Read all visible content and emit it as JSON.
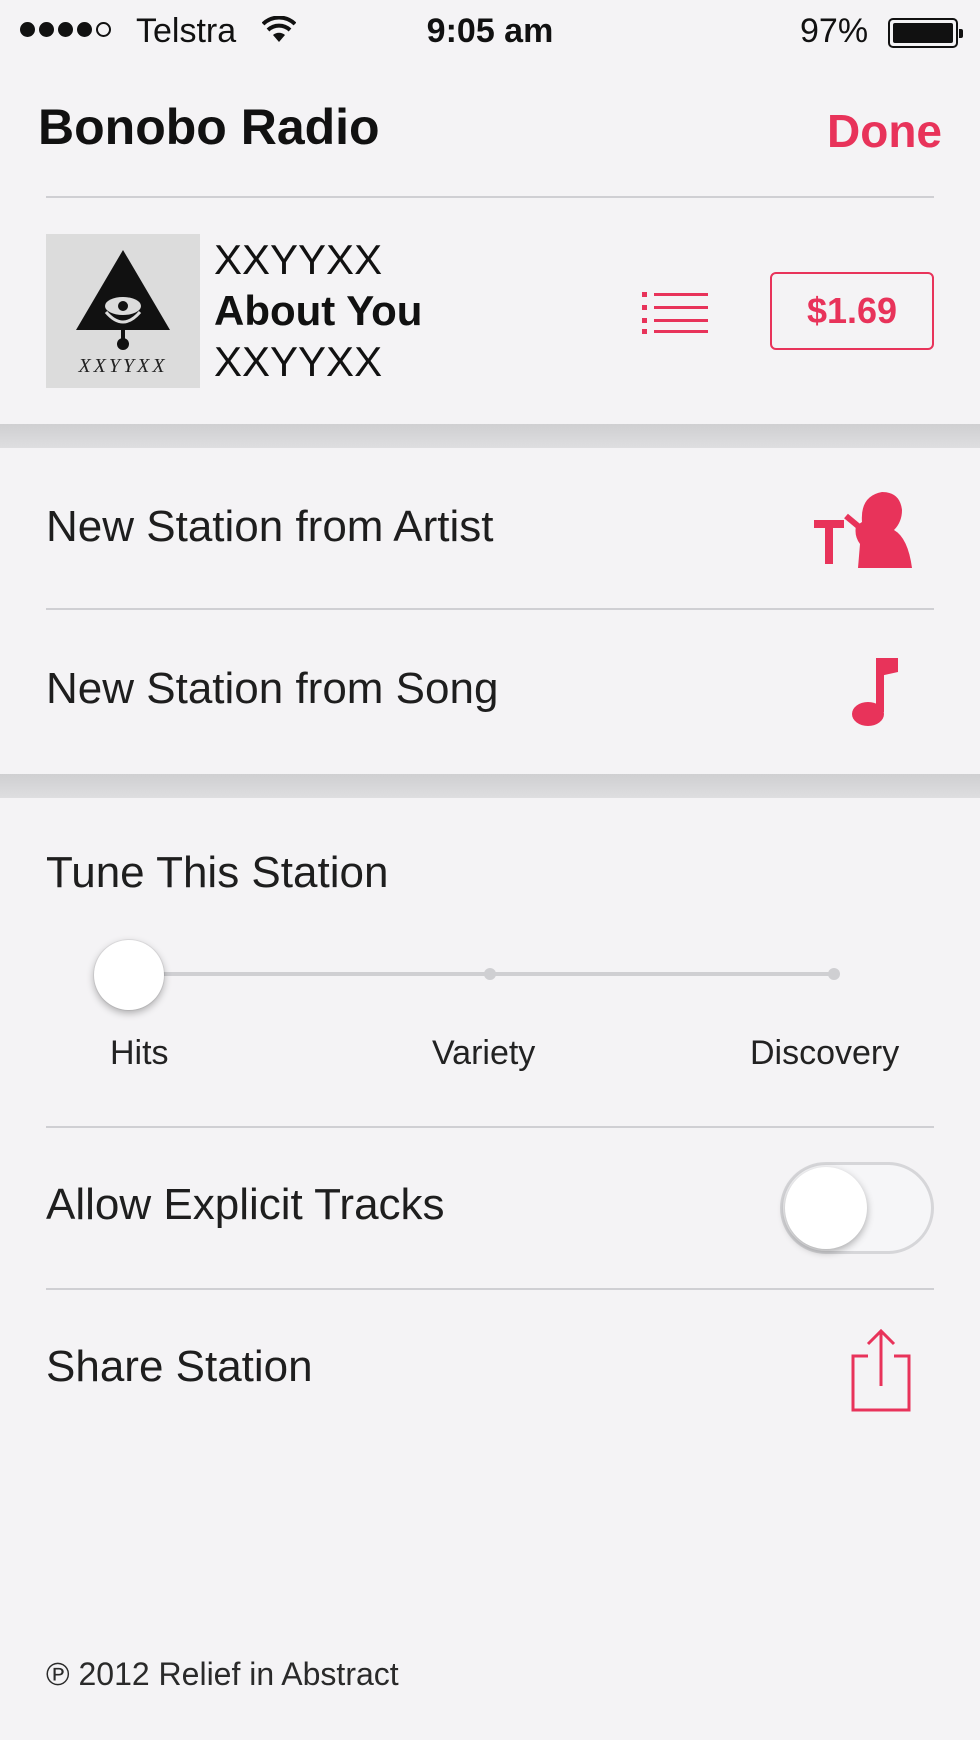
{
  "status_bar": {
    "carrier": "Telstra",
    "time": "9:05 am",
    "battery": "97%",
    "signal_strength_bars": 4
  },
  "header": {
    "title": "Bonobo Radio",
    "done_label": "Done"
  },
  "now_playing": {
    "artist": "XXYYXX",
    "song": "About You",
    "album": "XXYYXX",
    "album_art_text": "XXYYXX",
    "price": "$1.69",
    "list_icon": "track-list-icon"
  },
  "actions": {
    "new_from_artist": "New Station from Artist",
    "new_from_artist_icon": "artist-microphone-icon",
    "new_from_song": "New Station from Song",
    "new_from_song_icon": "music-note-icon"
  },
  "tune": {
    "title": "Tune This Station",
    "options": [
      "Hits",
      "Variety",
      "Discovery"
    ],
    "selected": "Hits"
  },
  "explicit": {
    "label": "Allow Explicit Tracks",
    "enabled": false
  },
  "share": {
    "label": "Share Station",
    "icon": "share-icon"
  },
  "footer": {
    "copyright": "℗ 2012 Relief in Abstract"
  },
  "colors": {
    "accent": "#e8335a",
    "background": "#f4f3f5",
    "separator": "#cfcfd3"
  }
}
